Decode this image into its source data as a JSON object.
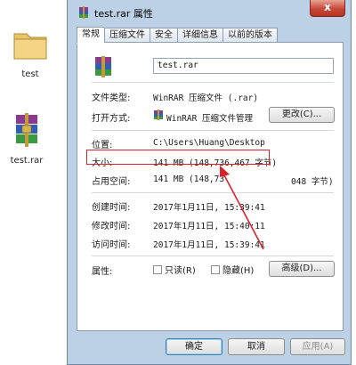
{
  "desktop": {
    "folder_label": "test",
    "rar_label": "test.rar"
  },
  "dialog": {
    "title": "test.rar 属性",
    "close_glyph": "x",
    "tabs": [
      "常规",
      "压缩文件",
      "安全",
      "详细信息",
      "以前的版本"
    ],
    "file_name": "test.rar",
    "file_type_label": "文件类型:",
    "file_type_value": "WinRAR 压缩文件 (.rar)",
    "open_with_label": "打开方式:",
    "open_with_value": "WinRAR 压缩文件管理",
    "change_button": "更改(C)...",
    "location_label": "位置:",
    "location_value": "C:\\Users\\Huang\\Desktop",
    "size_label": "大小:",
    "size_value": "141 MB (148,736,467 字节)",
    "size_on_disk_label": "占用空间:",
    "size_on_disk_value": "141 MB (148,73",
    "size_on_disk_tail": "048 字节)",
    "created_label": "创建时间:",
    "created_value": "2017年1月11日, 15:39:41",
    "modified_label": "修改时间:",
    "modified_value": "2017年1月11日, 15:40:11",
    "accessed_label": "访问时间:",
    "accessed_value": "2017年1月11日, 15:39:41",
    "attributes_label": "属性:",
    "readonly_label": "只读(R)",
    "hidden_label": "隐藏(H)",
    "advanced_button": "高级(D)...",
    "ok_button": "确定",
    "cancel_button": "取消",
    "apply_button": "应用(A)"
  },
  "colors": {
    "annotation": "#d9232b",
    "dialog_frame": "#bcd0e6"
  },
  "icons": {
    "folder": "folder-icon",
    "archive": "winrar-archive-icon"
  }
}
